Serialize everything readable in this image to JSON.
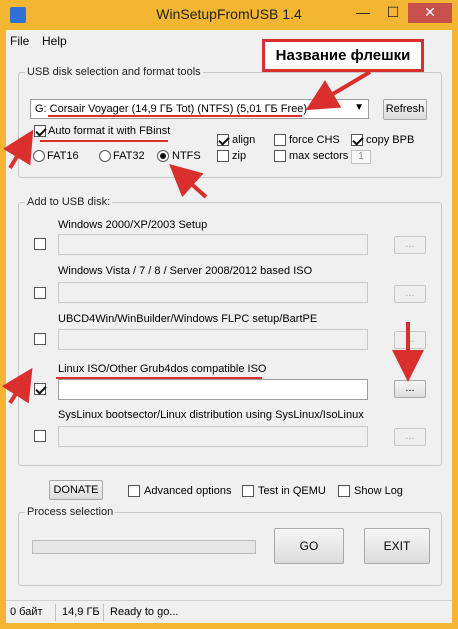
{
  "window": {
    "title": "WinSetupFromUSB 1.4",
    "min_glyph": "—",
    "max_glyph": "☐",
    "close_glyph": "✕"
  },
  "menu": {
    "file": "File",
    "help": "Help"
  },
  "usb_section": {
    "legend": "USB disk selection and format tools",
    "selected_disk": "G: Corsair Voyager (14,9 ГБ Tot) (NTFS) (5,01 ГБ Free)",
    "refresh_label": "Refresh",
    "auto_format_label": "Auto format it with FBinst",
    "auto_format_checked": true,
    "fs_options": [
      "FAT16",
      "FAT32",
      "NTFS"
    ],
    "fs_selected": "NTFS",
    "align_label": "align",
    "zip_label": "zip",
    "force_chs_label": "force CHS",
    "max_sectors_label": "max sectors",
    "max_sectors_value": "1",
    "copy_bpb_label": "copy BPB"
  },
  "add_section": {
    "legend": "Add to USB disk:",
    "items": [
      {
        "label": "Windows 2000/XP/2003 Setup",
        "checked": false,
        "value": "",
        "browse_label": "..."
      },
      {
        "label": "Windows Vista / 7 / 8 / Server 2008/2012 based ISO",
        "checked": false,
        "value": "",
        "browse_label": "..."
      },
      {
        "label": "UBCD4Win/WinBuilder/Windows FLPC setup/BartPE",
        "checked": false,
        "value": "",
        "browse_label": "..."
      },
      {
        "label": "Linux ISO/Other Grub4dos compatible ISO",
        "checked": true,
        "value": "",
        "browse_label": "..."
      },
      {
        "label": "SysLinux bootsector/Linux distribution using SysLinux/IsoLinux",
        "checked": false,
        "value": "",
        "browse_label": "..."
      }
    ]
  },
  "bottom": {
    "donate_label": "DONATE",
    "advanced_options_label": "Advanced options",
    "test_qemu_label": "Test in QEMU",
    "show_log_label": "Show Log"
  },
  "process": {
    "legend": "Process selection",
    "go_label": "GO",
    "exit_label": "EXIT",
    "progress": 0
  },
  "status": {
    "size_used": "0 байт",
    "size_total": "14,9 ГБ",
    "message": "Ready to go..."
  },
  "annotation": {
    "callout_text": "Название флешки"
  },
  "colors": {
    "accent": "#f2b632",
    "annotation": "#d9302e"
  }
}
